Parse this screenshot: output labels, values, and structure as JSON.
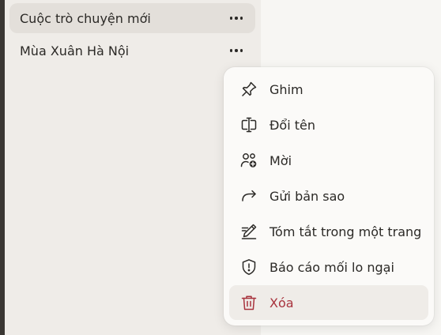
{
  "colors": {
    "sidebar_bg": "#efece8",
    "active_item_bg": "#e3dfda",
    "text": "#2b2926",
    "danger": "#a8333d",
    "menu_bg": "#fbfaf8"
  },
  "sidebar": {
    "conversations": [
      {
        "label": "Cuộc trò chuyện mới",
        "active": true
      },
      {
        "label": "Mùa Xuân Hà Nội",
        "active": false
      }
    ]
  },
  "context_menu": {
    "items": [
      {
        "label": "Ghim",
        "icon": "pin-icon"
      },
      {
        "label": "Đổi tên",
        "icon": "rename-icon"
      },
      {
        "label": "Mời",
        "icon": "invite-user-icon"
      },
      {
        "label": "Gửi bản sao",
        "icon": "share-arrow-icon"
      },
      {
        "label": "Tóm tắt trong một trang",
        "icon": "summarize-pen-icon"
      },
      {
        "label": "Báo cáo mối lo ngại",
        "icon": "report-shield-icon"
      },
      {
        "label": "Xóa",
        "icon": "trash-icon",
        "danger": true
      }
    ]
  }
}
